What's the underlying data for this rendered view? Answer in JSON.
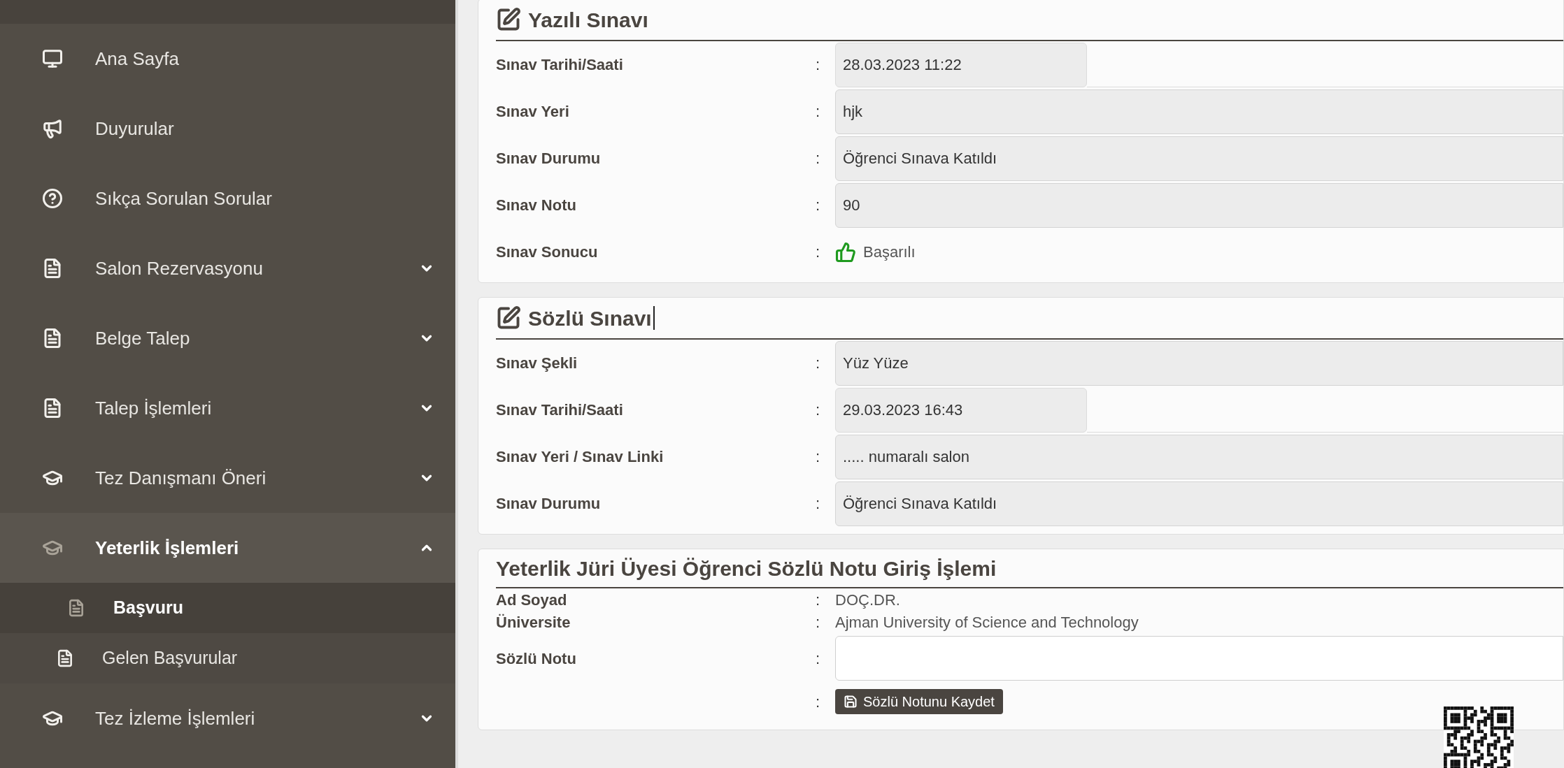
{
  "sidebar": {
    "items": [
      {
        "label": "Ana Sayfa"
      },
      {
        "label": "Duyurular"
      },
      {
        "label": "Sıkça Sorulan Sorular"
      },
      {
        "label": "Salon Rezervasyonu",
        "expanded": false
      },
      {
        "label": "Belge Talep",
        "expanded": false
      },
      {
        "label": "Talep İşlemleri",
        "expanded": false
      },
      {
        "label": "Tez Danışmanı Öneri",
        "expanded": false
      },
      {
        "label": "Yeterlik İşlemleri",
        "expanded": true,
        "children": [
          {
            "label": "Başvuru",
            "selected": true
          },
          {
            "label": "Gelen Başvurular",
            "selected": false
          }
        ]
      },
      {
        "label": "Tez İzleme İşlemleri",
        "expanded": false
      }
    ]
  },
  "sections": [
    {
      "title": "Yazılı Sınavı",
      "cursor": false,
      "rows": [
        {
          "label": "Sınav Tarihi/Saati",
          "sep": ":",
          "value": "28.03.2023 11:22",
          "kind": "short"
        },
        {
          "label": "Sınav Yeri",
          "sep": ":",
          "value": "hjk",
          "kind": "field"
        },
        {
          "label": "Sınav Durumu",
          "sep": ":",
          "value": "Öğrenci Sınava Katıldı",
          "kind": "field"
        },
        {
          "label": "Sınav Notu",
          "sep": ":",
          "value": "90",
          "kind": "field"
        },
        {
          "label": "Sınav Sonucu",
          "sep": ":",
          "value": "Başarılı",
          "kind": "result"
        }
      ]
    },
    {
      "title": "Sözlü Sınavı",
      "cursor": true,
      "rows": [
        {
          "label": "Sınav Şekli",
          "sep": ":",
          "value": "Yüz Yüze",
          "kind": "field"
        },
        {
          "label": "Sınav Tarihi/Saati",
          "sep": ":",
          "value": "29.03.2023 16:43",
          "kind": "short"
        },
        {
          "label": "Sınav Yeri / Sınav Linki",
          "sep": ":",
          "value": "..... numaralı salon",
          "kind": "field"
        },
        {
          "label": "Sınav Durumu",
          "sep": ":",
          "value": "Öğrenci Sınava Katıldı",
          "kind": "field"
        }
      ]
    }
  ],
  "grade_form": {
    "title": "Yeterlik Jüri Üyesi Öğrenci Sözlü Notu Giriş İşlemi",
    "rows": [
      {
        "label": "Ad Soyad",
        "sep": ":",
        "value": "DOÇ.DR."
      },
      {
        "label": "Üniversite",
        "sep": ":",
        "value": "Ajman University of Science and Technology"
      }
    ],
    "input": {
      "label": "Sözlü Notu",
      "sep": ":"
    },
    "save": {
      "sep": ":",
      "label": "Sözlü Notunu Kaydet"
    }
  }
}
